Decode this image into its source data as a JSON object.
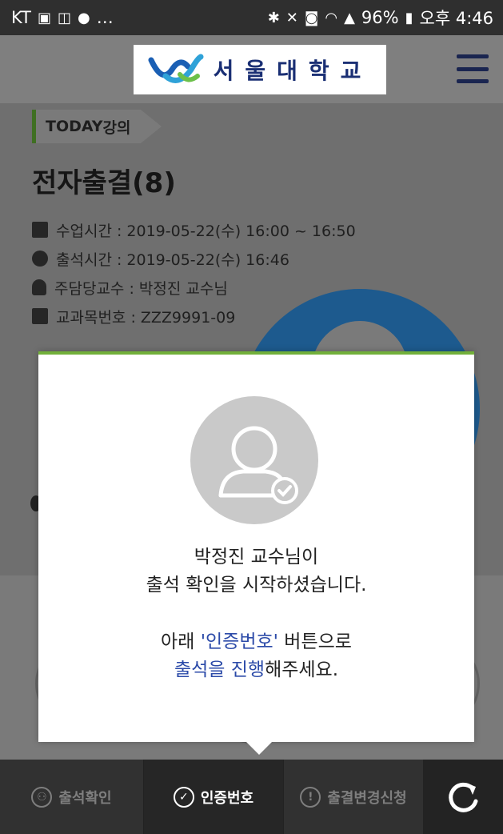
{
  "status_bar": {
    "carrier": "KT",
    "left_icons": [
      "image-icon",
      "chat-icon",
      "talk-icon",
      "more-dots"
    ],
    "right_icons": [
      "bluetooth-icon",
      "mute-icon",
      "hd-icon",
      "wifi-icon",
      "signal-icon"
    ],
    "battery": "96%",
    "time": "오후 4:46"
  },
  "header": {
    "logo_text": "서울대학교",
    "menu_icon": "hamburger-menu-icon"
  },
  "lecture": {
    "badge_bold": "TODAY",
    "badge_rest": " 강의",
    "title": "전자출결(8)",
    "class_time": "수업시간 : 2019-05-22(수) 16:00 ~ 16:50",
    "attend_time": "출석시간 : 2019-05-22(수) 16:46",
    "professor": "주담당교수 : 박정진 교수님",
    "course_no": "교과목번호 : ZZZ9991-09"
  },
  "modal": {
    "line1": "박정진 교수님이",
    "line2": "출석 확인을 시작하셨습니다.",
    "line3_pre": "아래 ",
    "line3_hl": "'인증번호'",
    "line3_post": " 버튼으로",
    "line4_hl": "출석을 진행",
    "line4_post": "해주세요."
  },
  "bottom_tabs": [
    {
      "label": "출석확인",
      "icon": "person-circle-icon",
      "active": false
    },
    {
      "label": "인증번호",
      "icon": "check-circle-icon",
      "active": true
    },
    {
      "label": "출결변경신청",
      "icon": "exclamation-circle-icon",
      "active": false
    }
  ],
  "colors": {
    "logo_navy": "#1a2f74",
    "modal_accent": "#72b03a",
    "highlight_blue": "#2b4aa8"
  }
}
